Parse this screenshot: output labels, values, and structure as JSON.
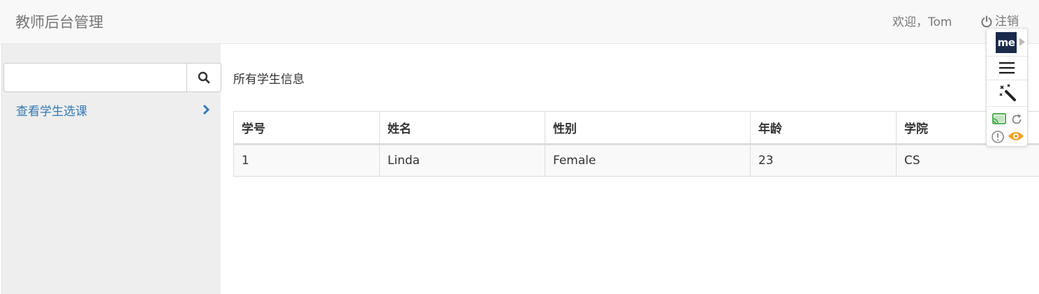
{
  "header": {
    "brand": "教师后台管理",
    "welcome": "欢迎，Tom",
    "logout_label": "注销"
  },
  "sidebar": {
    "search": {
      "value": "",
      "placeholder": ""
    },
    "items": [
      {
        "label": "查看学生选课"
      }
    ]
  },
  "main": {
    "title": "所有学生信息",
    "table": {
      "columns": [
        "学号",
        "姓名",
        "性别",
        "年龄",
        "学院"
      ],
      "rows": [
        [
          "1",
          "Linda",
          "Female",
          "23",
          "CS"
        ]
      ]
    }
  },
  "extension": {
    "logo_text": "me",
    "icons": [
      "menu-icon",
      "magic-wand-icon",
      "cast-icon",
      "refresh-icon",
      "alert-icon",
      "eye-icon"
    ]
  },
  "colors": {
    "link": "#337ab7",
    "navbar_bg": "#f8f8f8",
    "sidebar_bg": "#eeeeee",
    "eye_icon": "#f0a020",
    "cast_icon": "#4caf50"
  }
}
